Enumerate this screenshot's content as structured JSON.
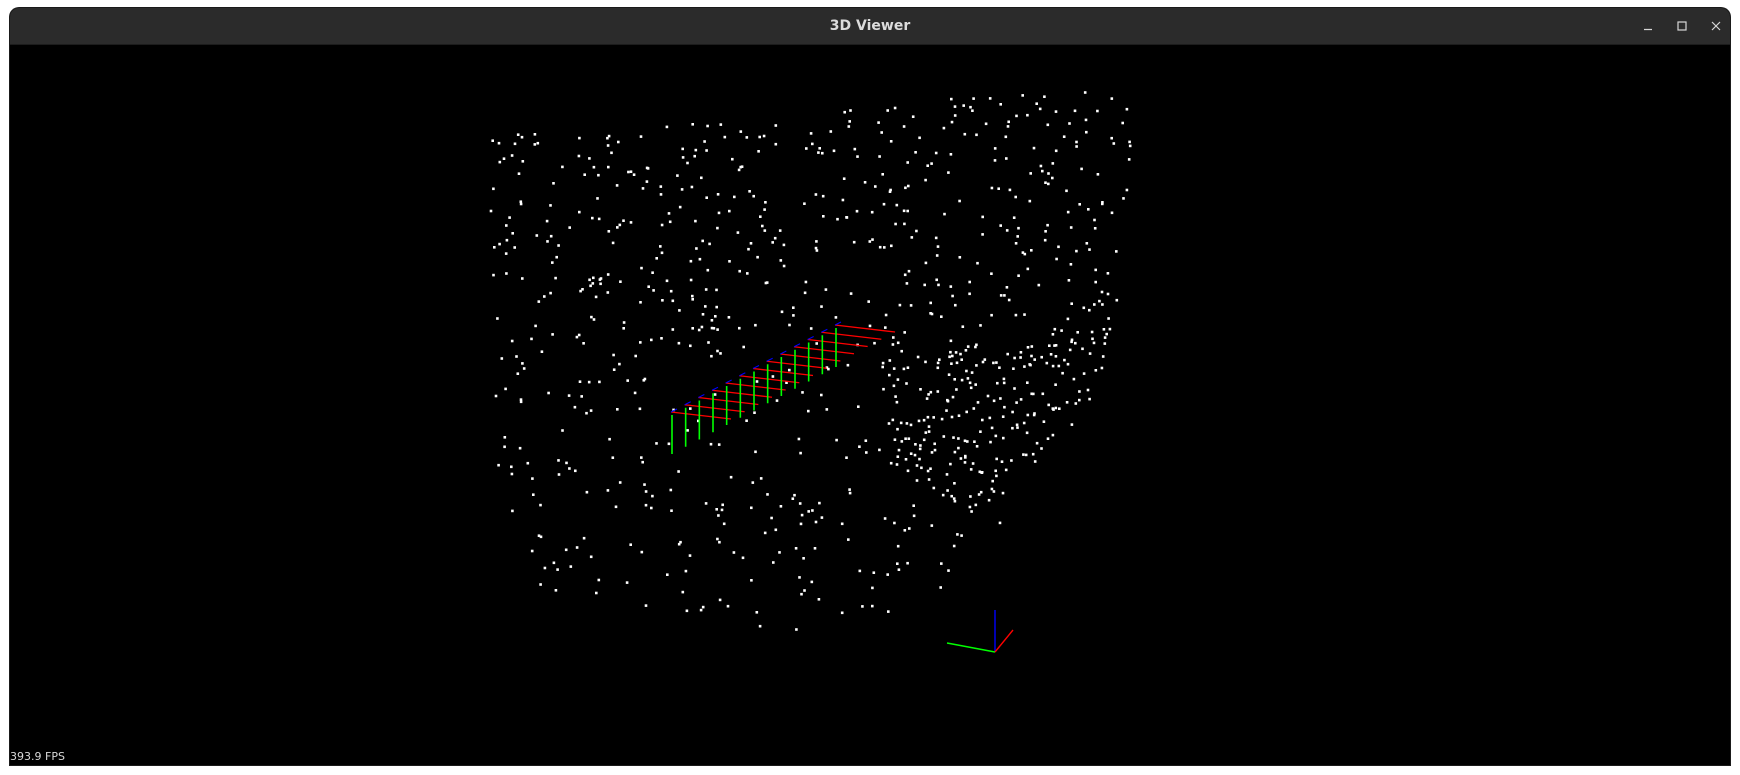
{
  "window": {
    "title": "3D Viewer",
    "controls": [
      {
        "name": "minimize",
        "icon": "minimize-icon"
      },
      {
        "name": "maximize",
        "icon": "maximize-icon"
      },
      {
        "name": "close",
        "icon": "close-icon"
      }
    ]
  },
  "viewport": {
    "background": "#000000",
    "point_color": "#ffffff",
    "axis_colors": {
      "x": "#ff0000",
      "y": "#00ff00",
      "z": "#0000ff"
    }
  },
  "status": {
    "fps": "393.9 FPS"
  }
}
